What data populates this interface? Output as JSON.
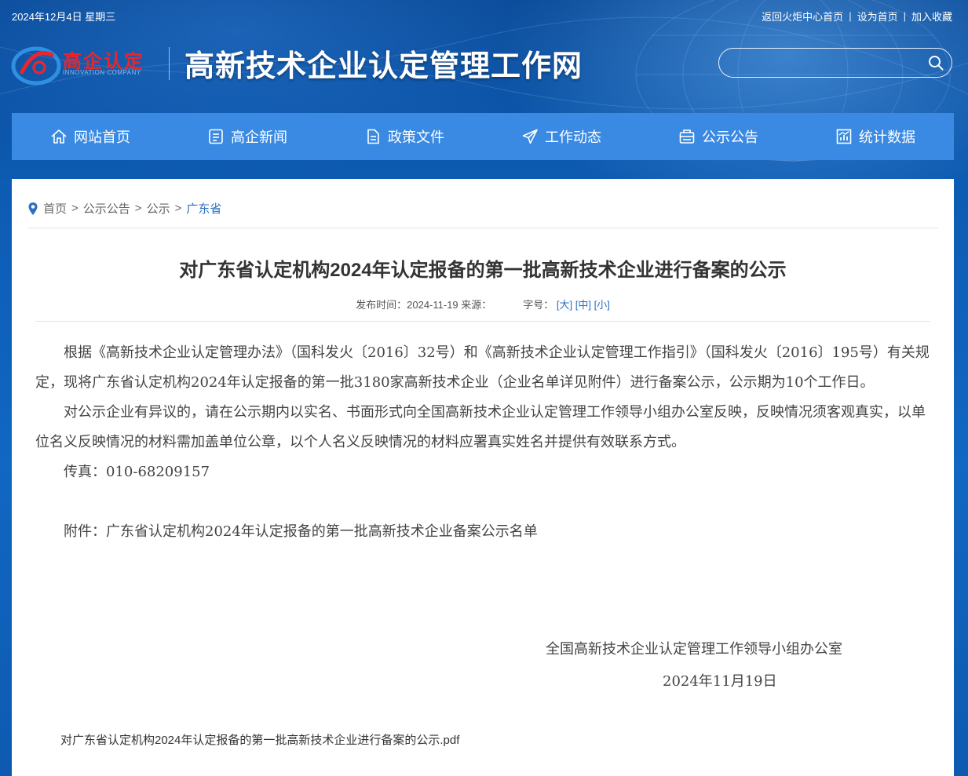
{
  "topbar": {
    "date": "2024年12月4日 星期三",
    "links": [
      "返回火炬中心首页",
      "设为首页",
      "加入收藏"
    ],
    "separator": "|"
  },
  "header": {
    "logo_text": "高企认定",
    "logo_sub": "INNOVATION COMPANY",
    "site_title": "高新技术企业认定管理工作网",
    "search_placeholder": ""
  },
  "nav": {
    "items": [
      {
        "label": "网站首页",
        "icon": "home-icon"
      },
      {
        "label": "高企新闻",
        "icon": "news-icon"
      },
      {
        "label": "政策文件",
        "icon": "document-icon"
      },
      {
        "label": "工作动态",
        "icon": "send-icon"
      },
      {
        "label": "公示公告",
        "icon": "notice-icon"
      },
      {
        "label": "统计数据",
        "icon": "chart-icon"
      }
    ]
  },
  "breadcrumb": {
    "items": [
      "首页",
      "公示公告",
      "公示"
    ],
    "current": "广东省",
    "arrow": ">"
  },
  "article": {
    "title": "对广东省认定机构2024年认定报备的第一批高新技术企业进行备案的公示",
    "meta": {
      "published": "发布时间：2024-11-19 来源：",
      "font_label": "字号：",
      "sizes": [
        "[大]",
        "[中]",
        "[小]"
      ]
    },
    "paragraphs": [
      "根据《高新技术企业认定管理办法》（国科发火〔2016〕32号）和《高新技术企业认定管理工作指引》（国科发火〔2016〕195号）有关规定，现将广东省认定机构2024年认定报备的第一批3180家高新技术企业（企业名单详见附件）进行备案公示，公示期为10个工作日。",
      "对公示企业有异议的，请在公示期内以实名、书面形式向全国高新技术企业认定管理工作领导小组办公室反映，反映情况须客观真实，以单位名义反映情况的材料需加盖单位公章，以个人名义反映情况的材料应署真实姓名并提供有效联系方式。",
      "传真：010-68209157"
    ],
    "attachment_line": "附件：广东省认定机构2024年认定报备的第一批高新技术企业备案公示名单",
    "signature_org": "全国高新技术企业认定管理工作领导小组办公室",
    "signature_date": "2024年11月19日",
    "pdf_link": "对广东省认定机构2024年认定报备的第一批高新技术企业进行备案的公示.pdf"
  }
}
